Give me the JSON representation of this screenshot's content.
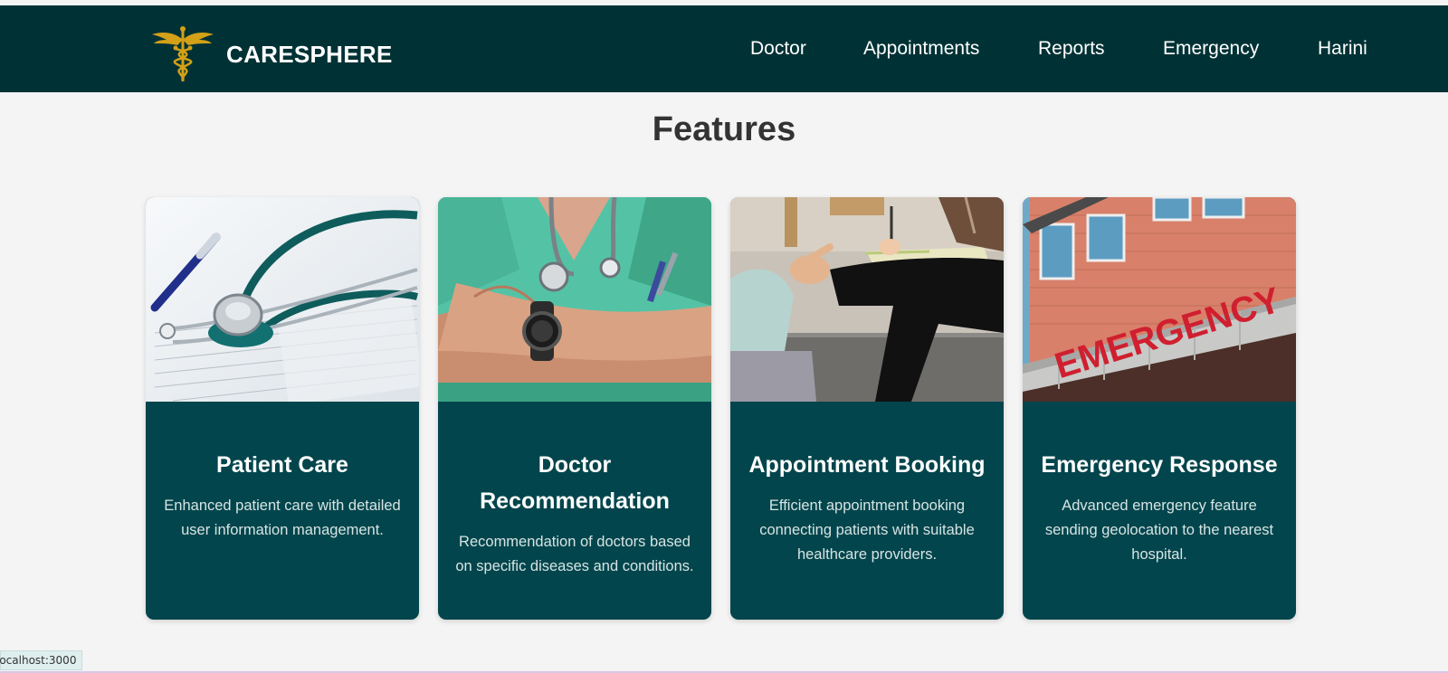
{
  "app": {
    "brand": "CARESPHERE",
    "logo_icon": "caduceus-icon",
    "colors": {
      "navbar": "#003235",
      "card": "#03454c",
      "gold": "#d4a017",
      "background": "#f4f4f4"
    }
  },
  "nav": {
    "doctor": "Doctor",
    "appointments": "Appointments",
    "reports": "Reports",
    "emergency": "Emergency",
    "user": "Harini"
  },
  "features": {
    "title": "Features",
    "cards": [
      {
        "image": "stethoscope-on-papers-photo",
        "title": "Patient Care",
        "description": "Enhanced patient care with detailed user information management."
      },
      {
        "image": "doctor-crossed-arms-photo",
        "title": "Doctor Recommendation",
        "description": "Recommendation of doctors based on specific diseases and conditions."
      },
      {
        "image": "consultation-notes-photo",
        "title": "Appointment Booking",
        "description": "Efficient appointment booking connecting patients with suitable healthcare providers."
      },
      {
        "image": "emergency-building-sign-photo",
        "title": "Emergency Response",
        "description": "Advanced emergency feature sending geolocation to the nearest hospital."
      }
    ]
  },
  "status_bar": {
    "url": "localhost:3000"
  },
  "emergency_sign_text": "EMERGENCY"
}
